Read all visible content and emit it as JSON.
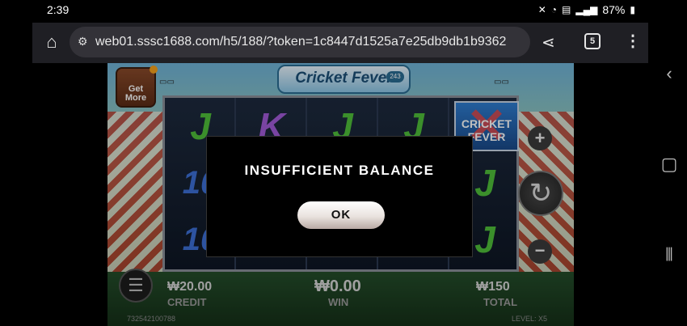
{
  "status_bar": {
    "time": "2:39",
    "battery": "87%",
    "icons": [
      "mute-icon",
      "wifi-icon",
      "hd-voice-icon",
      "signal-icon",
      "battery-icon"
    ]
  },
  "browser": {
    "url": "web01.sssc1688.com/h5/188/?token=1c8447d1525a7e25db9db1b9362",
    "tab_count": "5"
  },
  "game": {
    "logo_text": "Cricket Fever",
    "logo_badge": "243",
    "get_more_label": "Get More",
    "reels": [
      [
        "J",
        "10",
        "10"
      ],
      [
        "K",
        "",
        ""
      ],
      [
        "J",
        "",
        ""
      ],
      [
        "J",
        "",
        ""
      ],
      [
        "WILD",
        "J",
        "J"
      ]
    ],
    "wild_text": "CRICKET FEVER",
    "credit_value": "₩20.00",
    "credit_label": "CREDIT",
    "win_value": "₩0.00",
    "win_label": "WIN",
    "total_value": "₩150",
    "total_label": "TOTAL",
    "footer_id": "732542100788",
    "level_label": "LEVEL: X5"
  },
  "dialog": {
    "message": "INSUFFICIENT BALANCE",
    "ok_label": "OK"
  },
  "colors": {
    "browser_bar": "#1f1f24",
    "dialog_bg": "#000000",
    "j_symbol": "#4fbf3a",
    "k_symbol": "#a25bd8",
    "ten_symbol": "#3d6fd6"
  }
}
